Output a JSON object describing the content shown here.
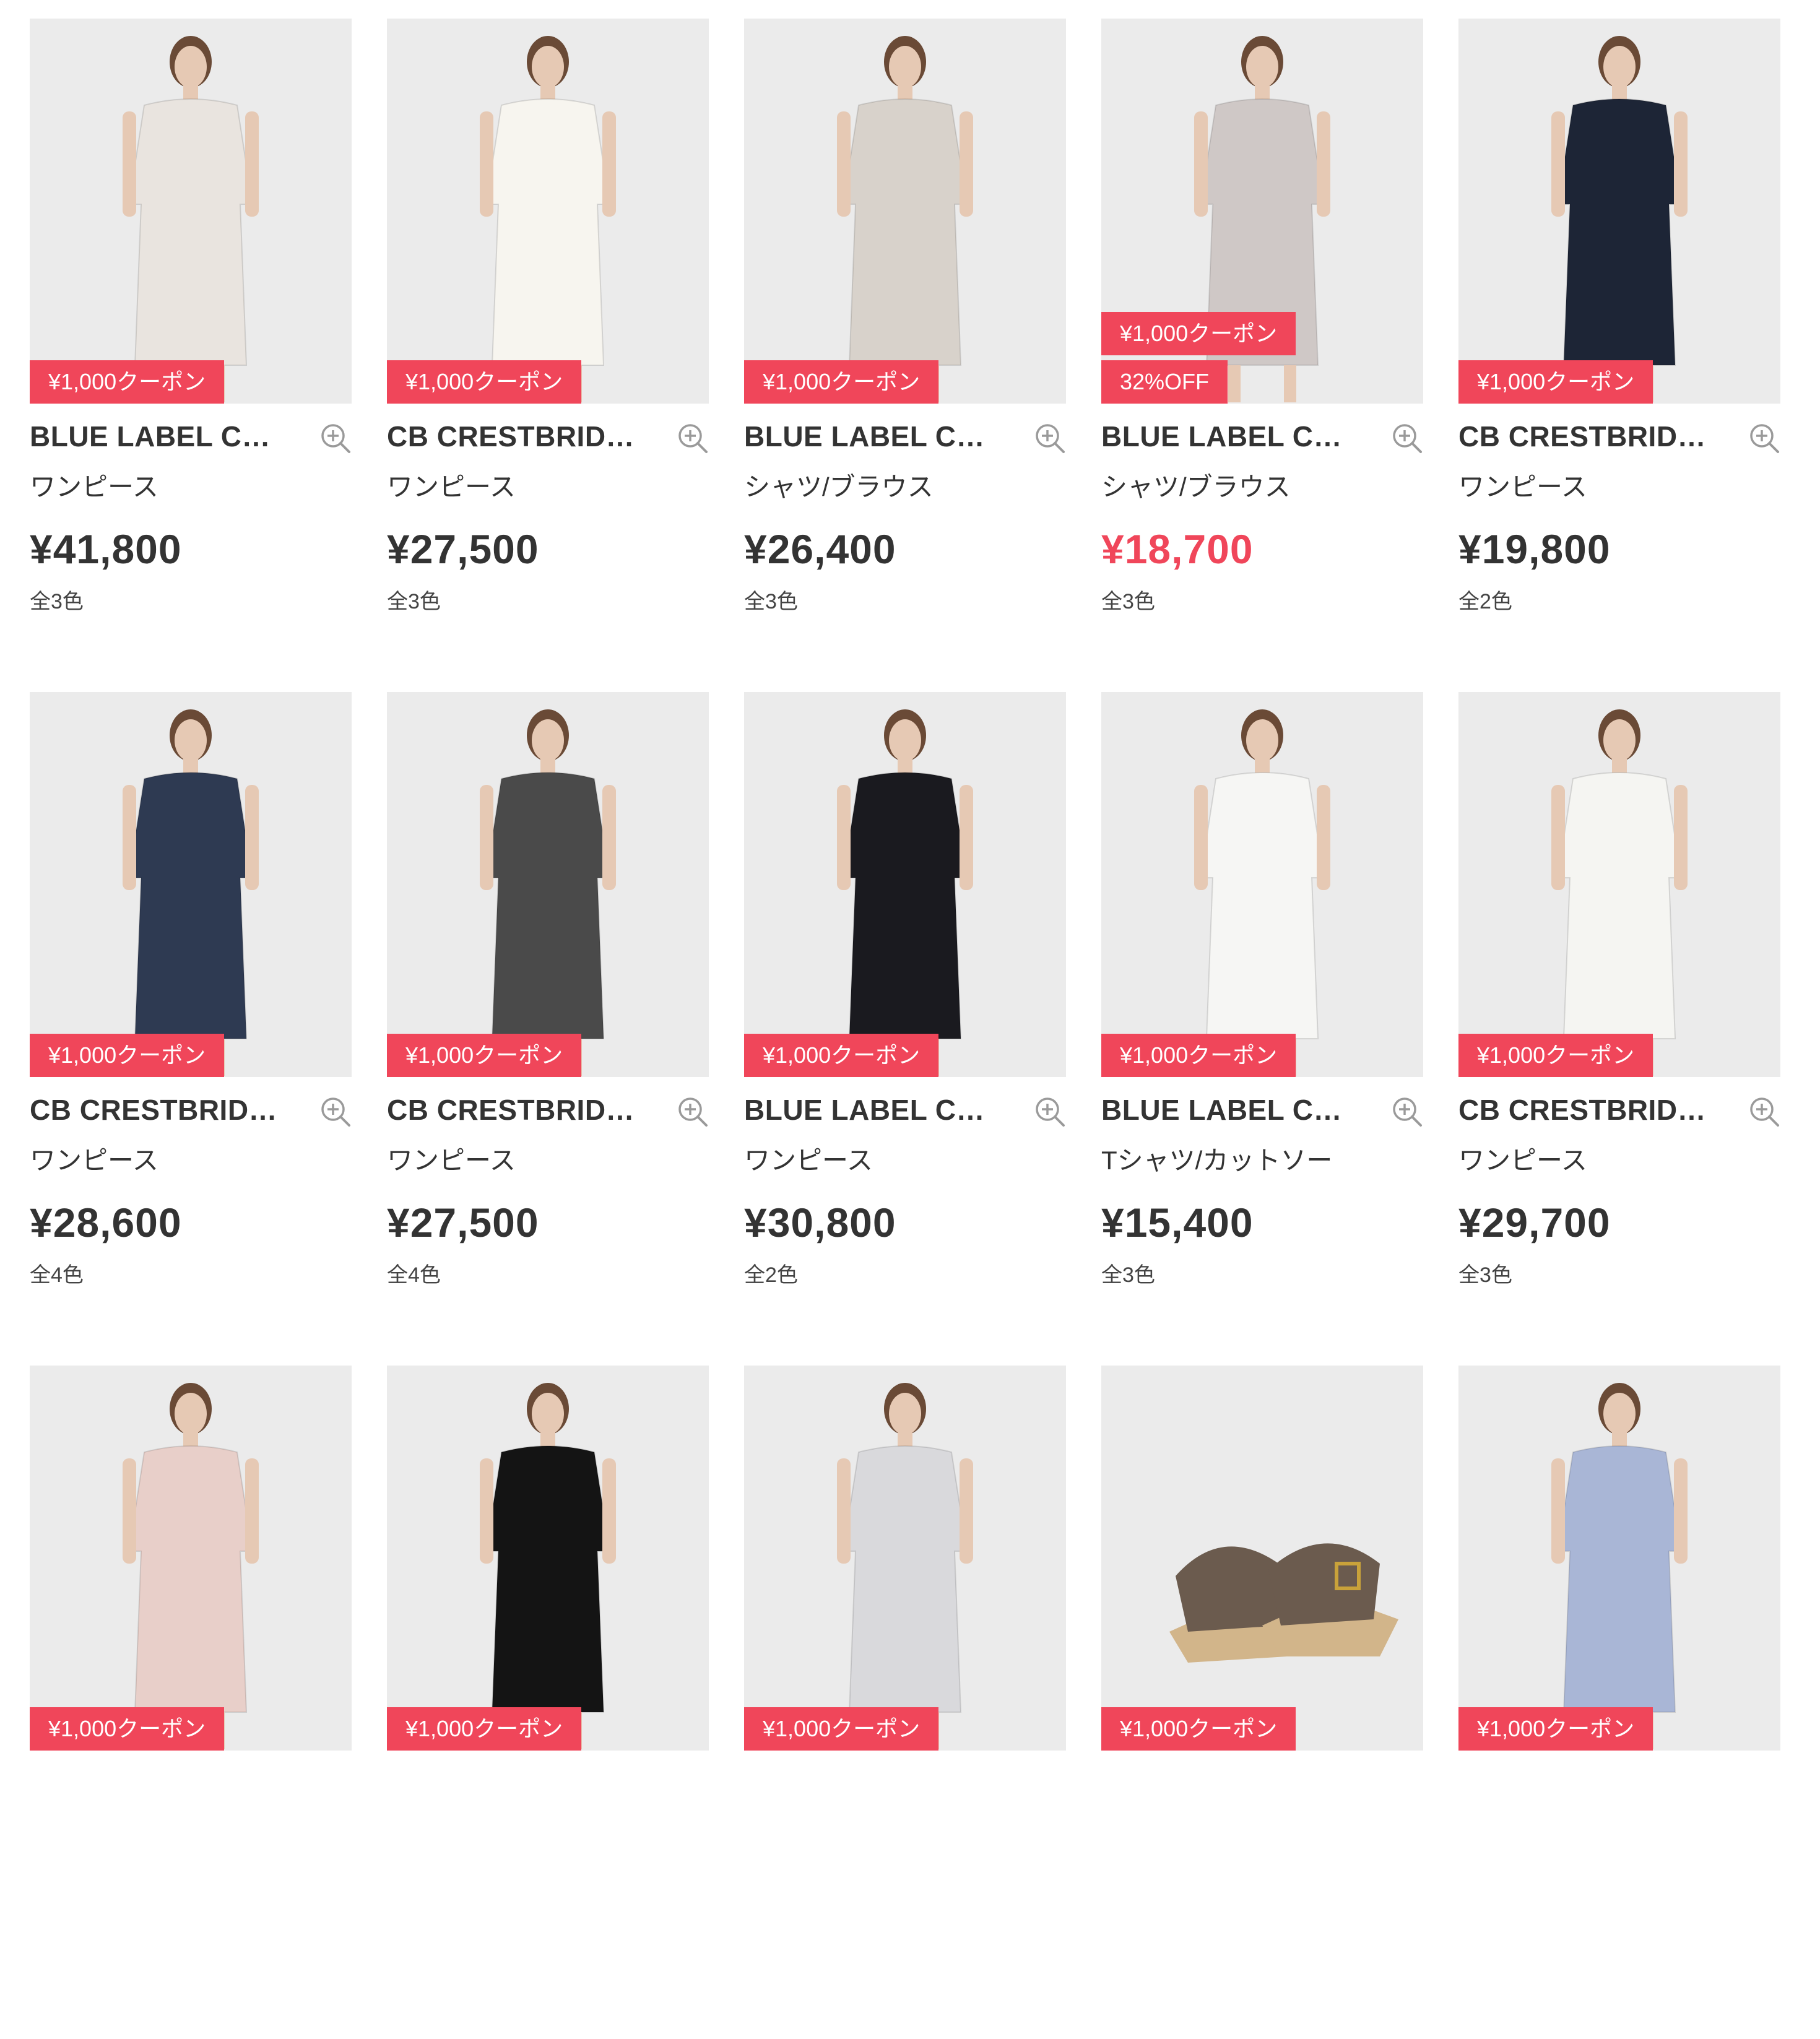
{
  "products": [
    {
      "brand": "BLUE LABEL C…",
      "category": "ワンピース",
      "price": "¥41,800",
      "colors": "全3色",
      "badges": [
        "¥1,000クーポン"
      ],
      "sale": false,
      "garment": "dress-check",
      "swatch": "#e9e4df"
    },
    {
      "brand": "CB CRESTBRID…",
      "category": "ワンピース",
      "price": "¥27,500",
      "colors": "全3色",
      "badges": [
        "¥1,000クーポン"
      ],
      "sale": false,
      "garment": "pinafore-white",
      "swatch": "#f7f5ef"
    },
    {
      "brand": "BLUE LABEL C…",
      "category": "シャツ/ブラウス",
      "price": "¥26,400",
      "colors": "全3色",
      "badges": [
        "¥1,000クーポン"
      ],
      "sale": false,
      "garment": "blouse-check",
      "swatch": "#d8d2cb"
    },
    {
      "brand": "BLUE LABEL C…",
      "category": "シャツ/ブラウス",
      "price": "¥18,700",
      "colors": "全3色",
      "badges": [
        "¥1,000クーポン",
        "32%OFF"
      ],
      "sale": true,
      "garment": "shirt-check-bow",
      "swatch": "#cfc8c6"
    },
    {
      "brand": "CB CRESTBRID…",
      "category": "ワンピース",
      "price": "¥19,800",
      "colors": "全2色",
      "badges": [
        "¥1,000クーポン"
      ],
      "sale": false,
      "garment": "tee-dress-navy",
      "swatch": "#1d2536"
    },
    {
      "brand": "CB CRESTBRID…",
      "category": "ワンピース",
      "price": "¥28,600",
      "colors": "全4色",
      "badges": [
        "¥1,000クーポン"
      ],
      "sale": false,
      "garment": "shirt-dress-navy",
      "swatch": "#2e3a52"
    },
    {
      "brand": "CB CRESTBRID…",
      "category": "ワンピース",
      "price": "¥27,500",
      "colors": "全4色",
      "badges": [
        "¥1,000クーポン"
      ],
      "sale": false,
      "garment": "dress-grey",
      "swatch": "#4a4a4a"
    },
    {
      "brand": "BLUE LABEL C…",
      "category": "ワンピース",
      "price": "¥30,800",
      "colors": "全2色",
      "badges": [
        "¥1,000クーポン"
      ],
      "sale": false,
      "garment": "dress-black",
      "swatch": "#1a1a1f"
    },
    {
      "brand": "BLUE LABEL C…",
      "category": "Tシャツ/カットソー",
      "price": "¥15,400",
      "colors": "全3色",
      "badges": [
        "¥1,000クーポン"
      ],
      "sale": false,
      "garment": "tee-white",
      "swatch": "#f6f6f4"
    },
    {
      "brand": "CB CRESTBRID…",
      "category": "ワンピース",
      "price": "¥29,700",
      "colors": "全3色",
      "badges": [
        "¥1,000クーポン"
      ],
      "sale": false,
      "garment": "dress-white-blue",
      "swatch": "#f5f5f2"
    },
    {
      "brand": "",
      "category": "",
      "price": "",
      "colors": "",
      "badges": [
        "¥1,000クーポン"
      ],
      "sale": false,
      "garment": "dress-pink",
      "swatch": "#e8cfc9"
    },
    {
      "brand": "",
      "category": "",
      "price": "",
      "colors": "",
      "badges": [
        "¥1,000クーポン"
      ],
      "sale": false,
      "garment": "tee-black-men",
      "swatch": "#141414"
    },
    {
      "brand": "",
      "category": "",
      "price": "",
      "colors": "",
      "badges": [
        "¥1,000クーポン"
      ],
      "sale": false,
      "garment": "dress-check-short",
      "swatch": "#d9d9dc"
    },
    {
      "brand": "",
      "category": "",
      "price": "",
      "colors": "",
      "badges": [
        "¥1,000クーポン"
      ],
      "sale": false,
      "garment": "sandals",
      "swatch": "#6b5b4e"
    },
    {
      "brand": "",
      "category": "",
      "price": "",
      "colors": "",
      "badges": [
        "¥1,000クーポン"
      ],
      "sale": false,
      "garment": "top-blue-bow",
      "swatch": "#a9b6d6"
    }
  ]
}
